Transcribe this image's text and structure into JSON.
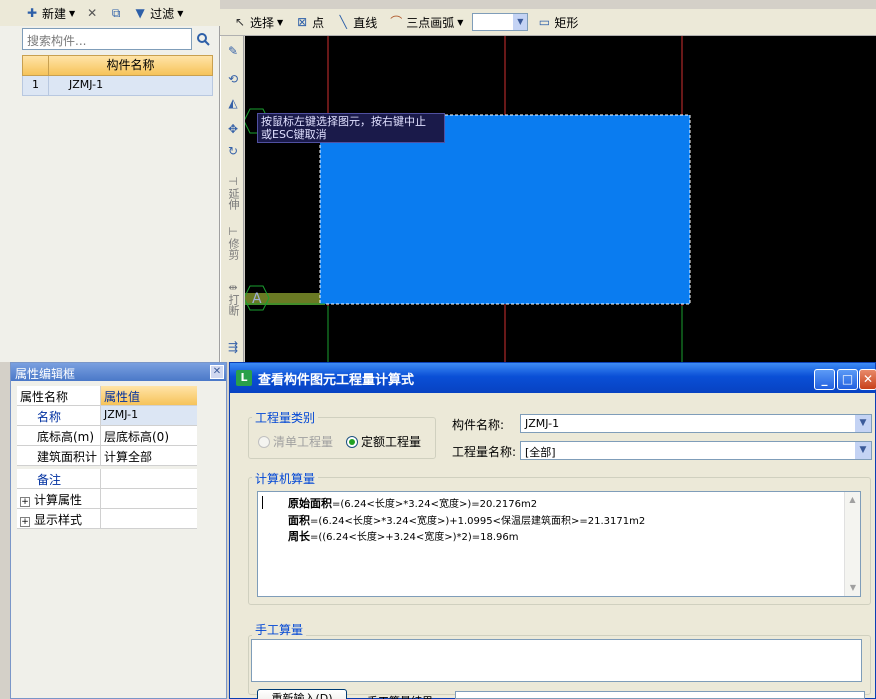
{
  "left_panel": {
    "toolbar": {
      "new_label": "新建",
      "filter_label": "过滤"
    },
    "search_placeholder": "搜索构件...",
    "table": {
      "header": "构件名称",
      "rows": [
        {
          "index": "1",
          "name": "JZMJ-1"
        }
      ]
    }
  },
  "top_toolbar": {
    "select_label": "选择",
    "point_label": "点",
    "line_label": "直线",
    "arc_label": "三点画弧",
    "rect_label": "矩形"
  },
  "vertical_toolbar": {
    "extend_label": "延伸",
    "trim_label": "修剪",
    "break_label": "打断"
  },
  "canvas": {
    "hint_line1": "按鼠标左键选择图元，按右键中止",
    "hint_line2": "或ESC键取消",
    "axis_label": "A",
    "accent": "#0a7cf0"
  },
  "properties": {
    "title": "属性编辑框",
    "col_name": "属性名称",
    "col_value": "属性值",
    "rows": [
      {
        "name": "名称",
        "value": "JZMJ-1"
      },
      {
        "name": "底标高(m)",
        "value": "层底标高(0)"
      },
      {
        "name": "建筑面积计",
        "value": "计算全部"
      },
      {
        "name": "备注",
        "value": ""
      },
      {
        "name": "计算属性",
        "value": ""
      },
      {
        "name": "显示样式",
        "value": ""
      }
    ]
  },
  "dialog": {
    "title": "查看构件图元工程量计算式",
    "qty_type_label": "工程量类别",
    "radio_list": "清单工程量",
    "radio_quota": "定额工程量",
    "component_name_label": "构件名称:",
    "component_name_value": "JZMJ-1",
    "qty_name_label": "工程量名称:",
    "qty_name_value": "[全部]",
    "computer_calc_label": "计算机算量",
    "formulas": [
      {
        "name": "原始面积",
        "expr": "=(6.24<长度>*3.24<宽度>)=20.2176m2"
      },
      {
        "name": "面积",
        "expr": "=(6.24<长度>*3.24<宽度>)+1.0995<保温层建筑面积>=21.3171m2"
      },
      {
        "name": "周长",
        "expr": "=((6.24<长度>+3.24<宽度>)*2)=18.96m"
      }
    ],
    "manual_calc_label": "手工算量",
    "reenter_label": "重新输入(D)",
    "manual_result_label": "手工算量结果="
  }
}
